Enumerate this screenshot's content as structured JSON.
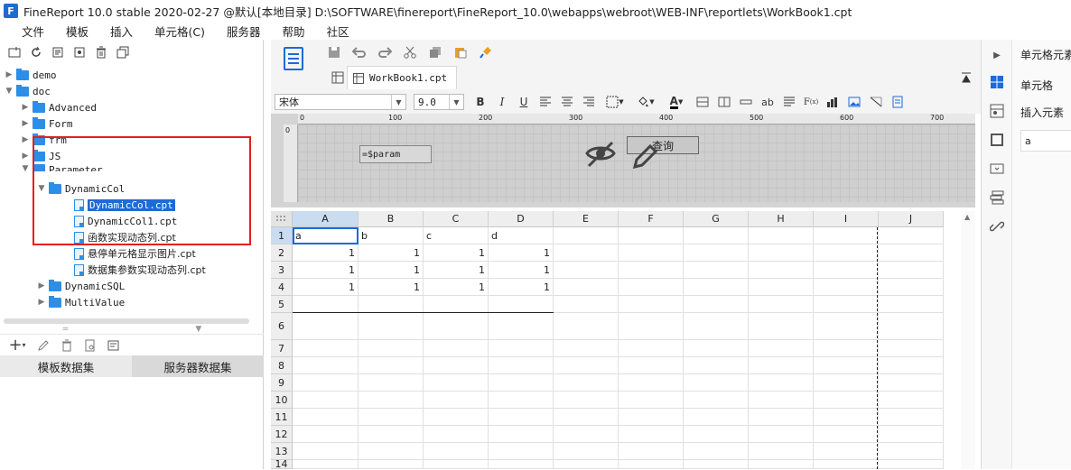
{
  "window": {
    "title": "FineReport 10.0 stable 2020-02-27 @默认[本地目录]    D:\\SOFTWARE\\finereport\\FineReport_10.0\\webapps\\webroot\\WEB-INF\\reportlets\\WorkBook1.cpt",
    "logo": "F"
  },
  "menu": [
    "文件",
    "模板",
    "插入",
    "单元格(C)",
    "服务器",
    "帮助",
    "社区"
  ],
  "tree": [
    {
      "label": "demo",
      "type": "folder",
      "depth": 0,
      "expanded": false
    },
    {
      "label": "doc",
      "type": "folder",
      "depth": 0,
      "expanded": true
    },
    {
      "label": "Advanced",
      "type": "folder",
      "depth": 1,
      "expanded": false
    },
    {
      "label": "Form",
      "type": "folder",
      "depth": 1,
      "expanded": false
    },
    {
      "label": "frm",
      "type": "folder",
      "depth": 1,
      "expanded": false
    },
    {
      "label": "JS",
      "type": "folder",
      "depth": 1,
      "expanded": false
    },
    {
      "label": "Parameter",
      "type": "folder",
      "depth": 1,
      "expanded": true
    },
    {
      "label": "DynamicCol",
      "type": "folder",
      "depth": 2,
      "expanded": true
    },
    {
      "label": "DynamicCol.cpt",
      "type": "file",
      "depth": 3,
      "selected": true
    },
    {
      "label": "DynamicCol1.cpt",
      "type": "file",
      "depth": 3
    },
    {
      "label": "函数实现动态列.cpt",
      "type": "file",
      "depth": 3
    },
    {
      "label": "悬停单元格显示图片.cpt",
      "type": "file",
      "depth": 3
    },
    {
      "label": "数据集参数实现动态列.cpt",
      "type": "file",
      "depth": 3
    },
    {
      "label": "DynamicSQL",
      "type": "folder",
      "depth": 2,
      "expanded": false
    },
    {
      "label": "MultiValue",
      "type": "folder",
      "depth": 2,
      "expanded": false
    }
  ],
  "dataset_tabs": {
    "template": "模板数据集",
    "server": "服务器数据集"
  },
  "document_tab": "WorkBook1.cpt",
  "format_toolbar": {
    "font": "宋体",
    "size": "9.0",
    "bold": "B",
    "italic": "I",
    "underline": "U"
  },
  "ruler_marks": [
    "0",
    "100",
    "200",
    "300",
    "400",
    "500",
    "600",
    "700"
  ],
  "param_widget_text": "=$param",
  "query_button_label": "查询",
  "grid": {
    "columns": [
      "A",
      "B",
      "C",
      "D",
      "E",
      "F",
      "G",
      "H",
      "I",
      "J"
    ],
    "rows": [
      "1",
      "2",
      "3",
      "4",
      "5",
      "6",
      "7",
      "8",
      "9",
      "10",
      "11",
      "12",
      "13",
      "14"
    ],
    "cells": {
      "r1": [
        "a",
        "b",
        "c",
        "d"
      ],
      "r2": [
        "1",
        "1",
        "1",
        "1"
      ],
      "r3": [
        "1",
        "1",
        "1",
        "1"
      ],
      "r4": [
        "1",
        "1",
        "1",
        "1"
      ]
    }
  },
  "right_panel": {
    "title": "单元格元素",
    "cell_label": "单元格",
    "insert_label": "插入元素",
    "value": "a"
  },
  "icons": {
    "left_toolbar": [
      "new-folder-icon",
      "refresh-icon",
      "open-icon",
      "settings-icon",
      "delete-icon",
      "copy-icon"
    ],
    "right_strip": [
      "cell-element-icon",
      "cell-attribute-icon",
      "border-icon",
      "widget-icon",
      "condition-icon",
      "link-icon"
    ]
  }
}
